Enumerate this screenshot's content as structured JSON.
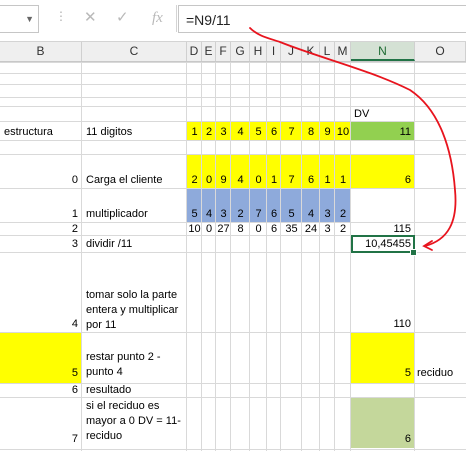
{
  "formula_bar": {
    "name_box": "",
    "cancel_icon": "✕",
    "enter_icon": "✓",
    "fx_icon": "fx",
    "formula": "=N9/11"
  },
  "columns": [
    "B",
    "C",
    "D",
    "E",
    "F",
    "G",
    "H",
    "I",
    "J",
    "K",
    "L",
    "M",
    "N",
    "O"
  ],
  "selected_column": "N",
  "cells": {
    "dv_label": "DV",
    "row_estructura": {
      "b": "estructura",
      "c": "11 digitos",
      "digits": [
        "1",
        "2",
        "3",
        "4",
        "5",
        "6",
        "7",
        "8",
        "9",
        "10"
      ],
      "n": "11"
    },
    "row_cliente": {
      "b": "0",
      "c": "Carga el cliente",
      "digits": [
        "2",
        "0",
        "9",
        "4",
        "0",
        "1",
        "7",
        "6",
        "1",
        "1"
      ],
      "n": "6"
    },
    "row_multiplicador": {
      "b": "1",
      "c": "multiplicador",
      "digits": [
        "5",
        "4",
        "3",
        "2",
        "7",
        "6",
        "5",
        "4",
        "3",
        "2"
      ]
    },
    "row_productos": {
      "b": "2",
      "digits": [
        "10",
        "0",
        "27",
        "8",
        "0",
        "6",
        "35",
        "24",
        "3",
        "2"
      ],
      "n": "115"
    },
    "row_dividir": {
      "b": "3",
      "c": "dividir /11",
      "n": "10,45455"
    },
    "row_parte_entera": {
      "b": "4",
      "c": "tomar solo la parte entera y multiplicar por 11",
      "n": "110"
    },
    "row_restar": {
      "b": "5",
      "c": "restar punto 2 - punto 4",
      "n": "5",
      "o": "reciduo"
    },
    "row_resultado": {
      "b": "6",
      "c": "resultado"
    },
    "row_final": {
      "b": "7",
      "c": "si el reciduo es mayor a 0 DV = 11- reciduo",
      "n": "6"
    }
  },
  "colors": {
    "yellow": "#ffff00",
    "green_dv": "#92d050",
    "blue": "#8eaadb",
    "light_green": "#c4d79b",
    "selection": "#217346",
    "annotation": "#e8141e"
  }
}
